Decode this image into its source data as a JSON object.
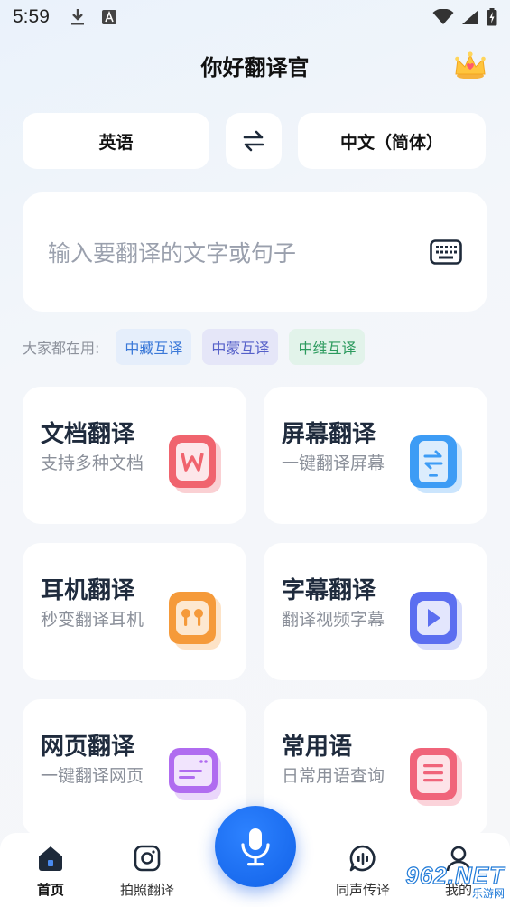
{
  "status_bar": {
    "time": "5:59"
  },
  "header": {
    "title": "你好翻译官",
    "vip_icon": "crown-icon"
  },
  "languages": {
    "source": "英语",
    "target": "中文（简体）",
    "swap_icon": "swap-icon"
  },
  "input": {
    "placeholder": "输入要翻译的文字或句子",
    "keyboard_icon": "keyboard-icon"
  },
  "popular": {
    "label": "大家都在用:",
    "chips": [
      "中藏互译",
      "中蒙互译",
      "中维互译"
    ]
  },
  "features": [
    {
      "title": "文档翻译",
      "subtitle": "支持多种文档",
      "icon": "document-icon",
      "color": "#f0646e"
    },
    {
      "title": "屏幕翻译",
      "subtitle": "一键翻译屏幕",
      "icon": "phone-screen-icon",
      "color": "#3d9cf5"
    },
    {
      "title": "耳机翻译",
      "subtitle": "秒变翻译耳机",
      "icon": "earbuds-icon",
      "color": "#f59a3a"
    },
    {
      "title": "字幕翻译",
      "subtitle": "翻译视频字幕",
      "icon": "play-icon",
      "color": "#5b6ef0"
    },
    {
      "title": "网页翻译",
      "subtitle": "一键翻译网页",
      "icon": "webpage-icon",
      "color": "#b06cf0"
    },
    {
      "title": "常用语",
      "subtitle": "日常用语查询",
      "icon": "list-icon",
      "color": "#f0647a"
    }
  ],
  "tabbar": {
    "items": [
      {
        "label": "首页",
        "icon": "home-icon"
      },
      {
        "label": "拍照翻译",
        "icon": "camera-icon"
      },
      {
        "label": "同声传译",
        "icon": "speech-icon"
      },
      {
        "label": "我的",
        "icon": "profile-icon"
      }
    ],
    "mic_icon": "microphone-icon"
  },
  "watermark": {
    "main": "962.NET",
    "sub": "乐游网"
  }
}
